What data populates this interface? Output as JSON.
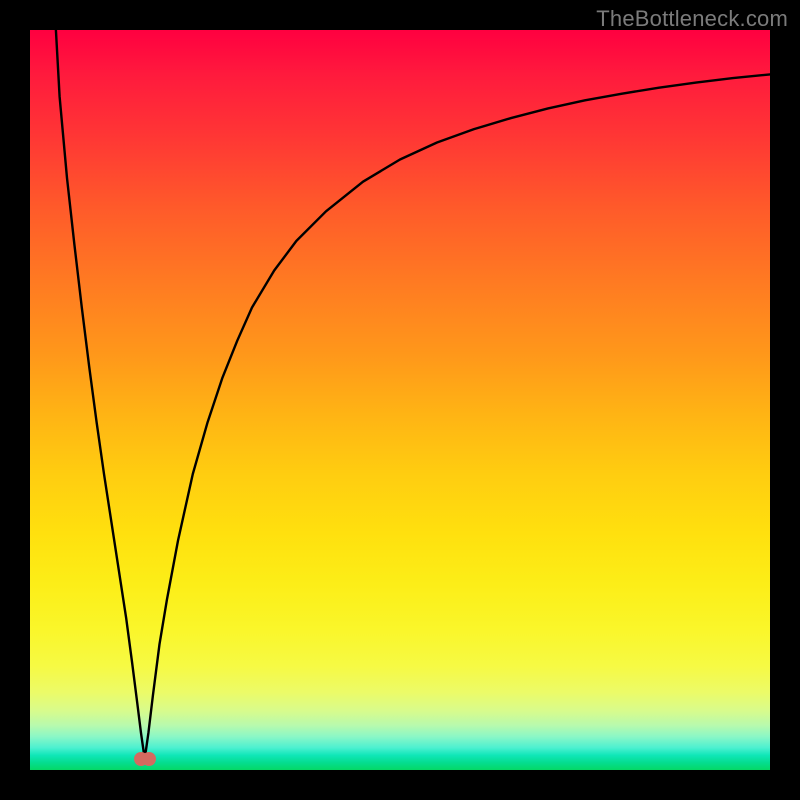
{
  "watermark": {
    "text": "TheBottleneck.com"
  },
  "chart_data": {
    "type": "line",
    "title": "",
    "xlabel": "",
    "ylabel": "",
    "xlim": [
      0,
      100
    ],
    "ylim": [
      0,
      100
    ],
    "grid": false,
    "legend": false,
    "background": "vertical-gradient red→orange→yellow→green",
    "marker": {
      "x": 15.5,
      "y": 1.5,
      "shape": "double-lobe",
      "color": "#d46a5f"
    },
    "series": [
      {
        "name": "bottleneck-curve",
        "color": "#000000",
        "x": [
          3.5,
          4,
          5,
          6,
          7,
          8,
          9,
          10,
          11,
          12,
          13,
          13.8,
          14.5,
          15,
          15.5,
          16,
          16.6,
          17.5,
          18.5,
          20,
          22,
          24,
          26,
          28,
          30,
          33,
          36,
          40,
          45,
          50,
          55,
          60,
          65,
          70,
          75,
          80,
          85,
          90,
          95,
          100
        ],
        "y": [
          100,
          91,
          80,
          71,
          62.5,
          54.5,
          47,
          40,
          33.5,
          27,
          20.5,
          14.5,
          9,
          5,
          1.5,
          5,
          10,
          17,
          23,
          31,
          40,
          47,
          53,
          58,
          62.5,
          67.5,
          71.5,
          75.5,
          79.5,
          82.5,
          84.8,
          86.6,
          88.1,
          89.4,
          90.5,
          91.4,
          92.2,
          92.9,
          93.5,
          94
        ]
      }
    ]
  }
}
